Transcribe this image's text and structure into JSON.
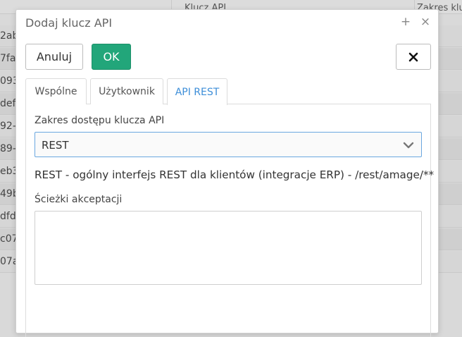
{
  "background": {
    "columns": [
      "Klucz API",
      "Zakres klu"
    ],
    "rows": [
      "2ab",
      "7fa-",
      "093",
      "def",
      "92-",
      "89-",
      "eb3",
      "49b",
      "dfd",
      "c07-",
      "07a"
    ]
  },
  "dialog": {
    "title": "Dodaj klucz API",
    "plus_icon": "+",
    "close_icon": "×",
    "buttons": {
      "cancel": "Anuluj",
      "ok": "OK",
      "discard": "✕"
    },
    "tabs": [
      {
        "label": "Wspólne"
      },
      {
        "label": "Użytkownik"
      },
      {
        "label": "API REST"
      }
    ],
    "active_tab": "API REST",
    "scope": {
      "label": "Zakres dostępu klucza API",
      "value": "REST"
    },
    "description": "REST - ogólny interfejs REST dla klientów (integracje ERP) - /rest/amage/**",
    "paths": {
      "label": "Ścieżki akceptacji",
      "value": ""
    }
  },
  "colors": {
    "ok_button": "#22a67a",
    "active_tab": "#3d8ed8",
    "select_border": "#6aa7e0"
  }
}
